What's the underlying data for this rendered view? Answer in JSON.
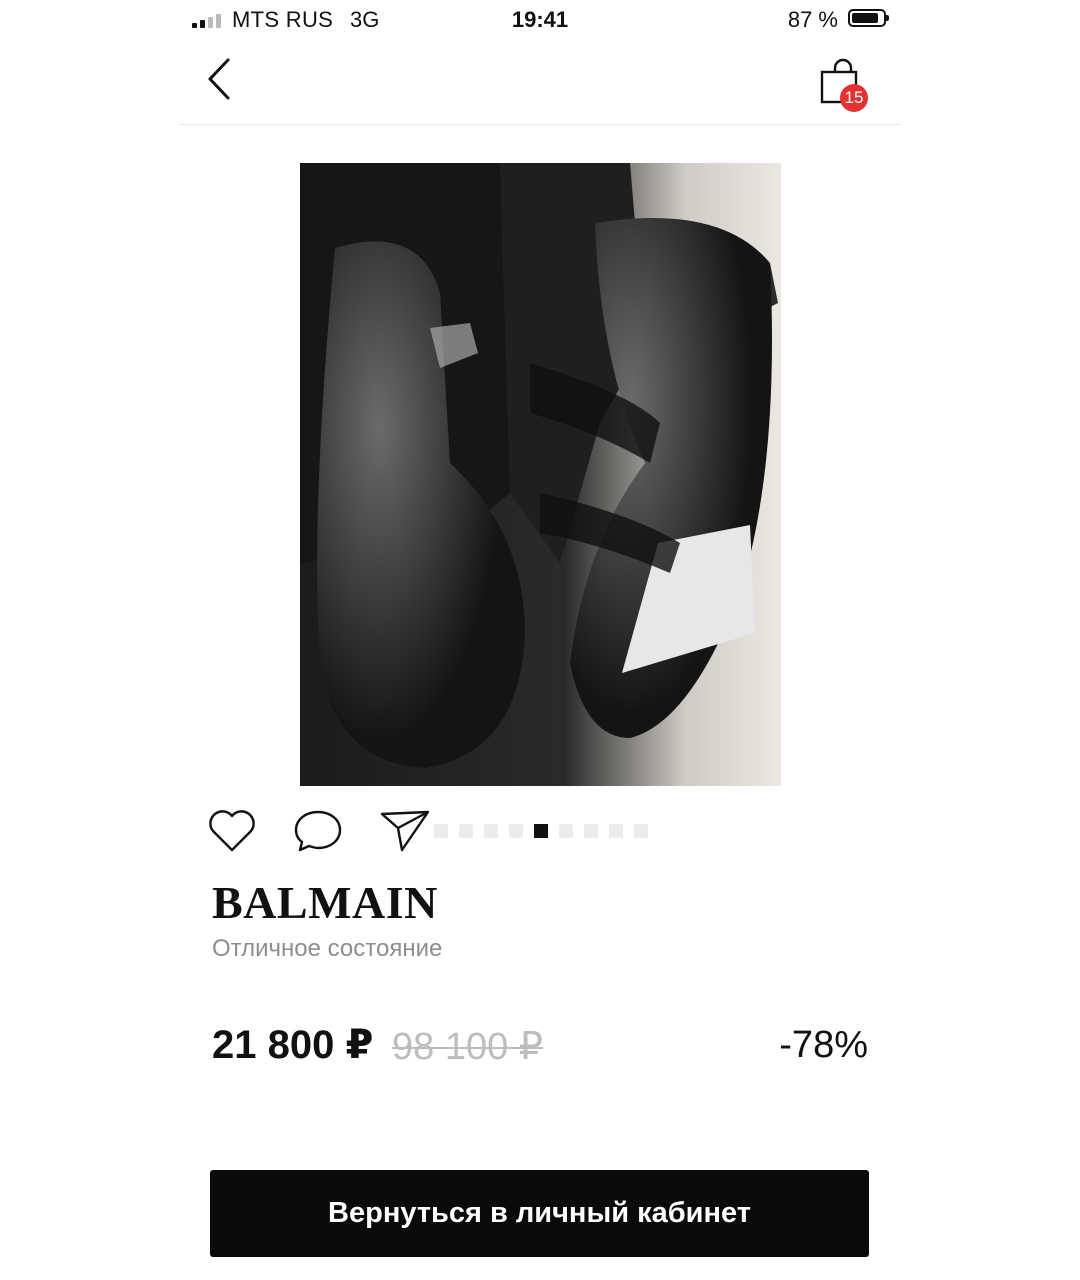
{
  "status_bar": {
    "carrier": "MTS RUS",
    "network": "3G",
    "time": "19:41",
    "battery_text": "87 %",
    "battery_level": 0.87
  },
  "nav": {
    "back_icon": "chevron-left-icon",
    "cart_icon": "shopping-bag-icon",
    "cart_count": "15"
  },
  "gallery": {
    "image_description_icon": "product-photo",
    "total_images": 9,
    "active_index": 4
  },
  "actions": {
    "like_icon": "heart-icon",
    "comment_icon": "comment-icon",
    "share_icon": "send-icon"
  },
  "product": {
    "brand": "BALMAIN",
    "condition": "Отличное состояние",
    "price": "21 800 ₽",
    "old_price": "98 100 ₽",
    "discount": "-78%"
  },
  "cta": {
    "label": "Вернуться в личный кабинет"
  },
  "colors": {
    "badge": "#e53131",
    "button": "#0a0a0a",
    "muted": "#8e8e8e"
  }
}
